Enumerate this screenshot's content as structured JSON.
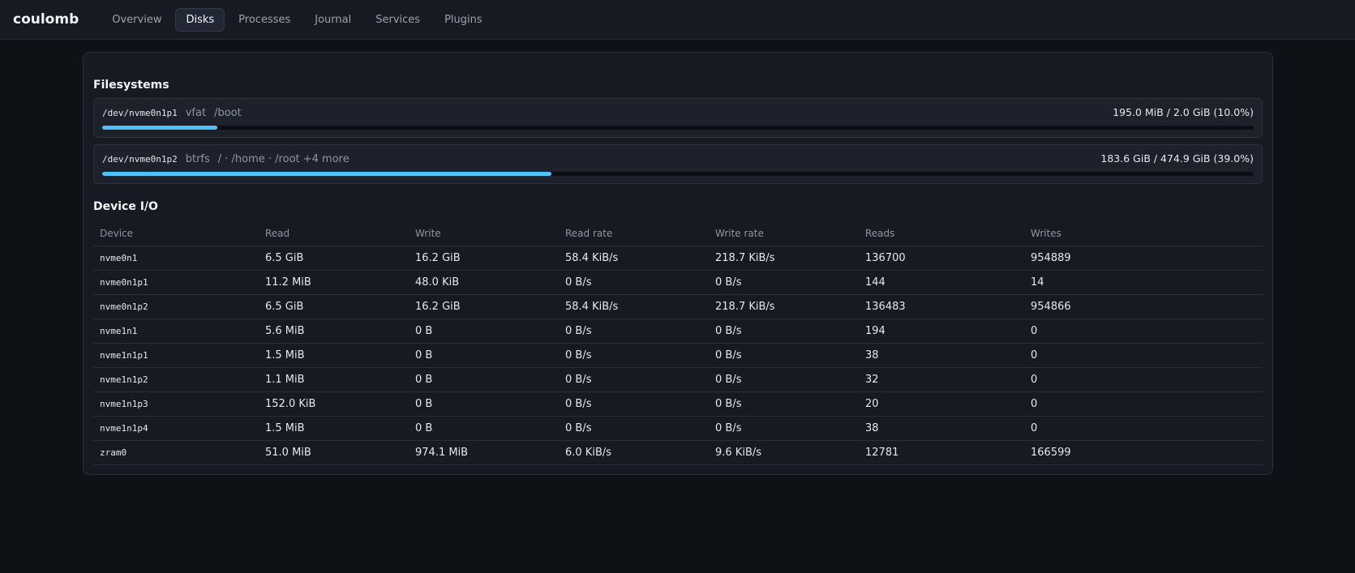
{
  "app": {
    "title": "coulomb"
  },
  "nav": {
    "tabs": [
      {
        "label": "Overview",
        "active": false
      },
      {
        "label": "Disks",
        "active": true
      },
      {
        "label": "Processes",
        "active": false
      },
      {
        "label": "Journal",
        "active": false
      },
      {
        "label": "Services",
        "active": false
      },
      {
        "label": "Plugins",
        "active": false
      }
    ]
  },
  "filesystems": {
    "title": "Filesystems",
    "items": [
      {
        "device": "/dev/nvme0n1p1",
        "type": "vfat",
        "mounts": "/boot",
        "usage": "195.0 MiB / 2.0 GiB (10.0%)",
        "percent": 10.0
      },
      {
        "device": "/dev/nvme0n1p2",
        "type": "btrfs",
        "mounts": "/ · /home · /root +4 more",
        "usage": "183.6 GiB / 474.9 GiB (39.0%)",
        "percent": 39.0
      }
    ]
  },
  "device_io": {
    "title": "Device I/O",
    "columns": [
      "Device",
      "Read",
      "Write",
      "Read rate",
      "Write rate",
      "Reads",
      "Writes"
    ],
    "rows": [
      [
        "nvme0n1",
        "6.5 GiB",
        "16.2 GiB",
        "58.4 KiB/s",
        "218.7 KiB/s",
        "136700",
        "954889"
      ],
      [
        "nvme0n1p1",
        "11.2 MiB",
        "48.0 KiB",
        "0 B/s",
        "0 B/s",
        "144",
        "14"
      ],
      [
        "nvme0n1p2",
        "6.5 GiB",
        "16.2 GiB",
        "58.4 KiB/s",
        "218.7 KiB/s",
        "136483",
        "954866"
      ],
      [
        "nvme1n1",
        "5.6 MiB",
        "0 B",
        "0 B/s",
        "0 B/s",
        "194",
        "0"
      ],
      [
        "nvme1n1p1",
        "1.5 MiB",
        "0 B",
        "0 B/s",
        "0 B/s",
        "38",
        "0"
      ],
      [
        "nvme1n1p2",
        "1.1 MiB",
        "0 B",
        "0 B/s",
        "0 B/s",
        "32",
        "0"
      ],
      [
        "nvme1n1p3",
        "152.0 KiB",
        "0 B",
        "0 B/s",
        "0 B/s",
        "20",
        "0"
      ],
      [
        "nvme1n1p4",
        "1.5 MiB",
        "0 B",
        "0 B/s",
        "0 B/s",
        "38",
        "0"
      ],
      [
        "zram0",
        "51.0 MiB",
        "974.1 MiB",
        "6.0 KiB/s",
        "9.6 KiB/s",
        "12781",
        "166599"
      ]
    ]
  },
  "colors": {
    "accent": "#4fc3f7",
    "background": "#0e1116",
    "panel": "#161a22"
  }
}
